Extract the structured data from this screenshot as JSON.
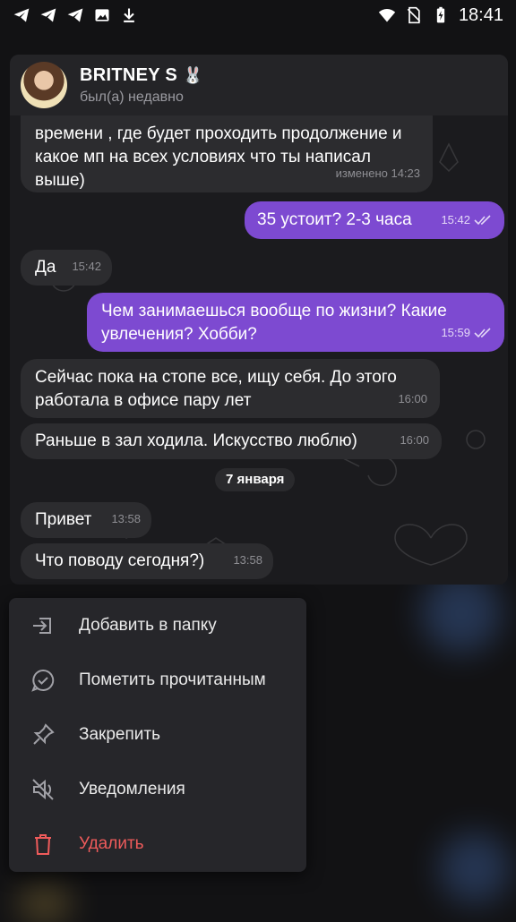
{
  "status_bar": {
    "time": "18:41",
    "left_icons": [
      "telegram-icon",
      "telegram-icon",
      "telegram-icon",
      "image-icon",
      "download-icon"
    ],
    "right_icons": [
      "wifi-icon",
      "no-sim-icon",
      "battery-charging-icon"
    ]
  },
  "chat": {
    "name": "BRITNEY S",
    "name_emoji": "🐰",
    "status": "был(а) недавно",
    "messages": [
      {
        "dir": "in",
        "text": "времени , где будет проходить продолжение и какое мп на всех условиях что ты написал выше)",
        "time": "изменено 14:23"
      },
      {
        "dir": "out",
        "text": "35 устоит? 2-3 часа",
        "time": "15:42",
        "read": true
      },
      {
        "dir": "in",
        "text": "Да",
        "time": "15:42"
      },
      {
        "dir": "out",
        "text": "Чем занимаешься вообще по жизни? Какие увлечения? Хобби?",
        "time": "15:59",
        "read": true
      },
      {
        "dir": "in",
        "text": "Сейчас пока на стопе все, ищу себя. До этого работала в офисе пару лет",
        "time": "16:00"
      },
      {
        "dir": "in",
        "text": "Раньше в зал ходила. Искусство люблю)",
        "time": "16:00"
      },
      {
        "dir": "in",
        "text": "Привет",
        "time": "13:58"
      },
      {
        "dir": "in",
        "text": "Что поводу сегодня?)",
        "time": "13:58"
      }
    ],
    "date_separator": "7 января"
  },
  "menu": {
    "items": [
      {
        "label": "Добавить в папку",
        "icon": "folder-add-icon"
      },
      {
        "label": "Пометить прочитанным",
        "icon": "mark-read-icon"
      },
      {
        "label": "Закрепить",
        "icon": "pin-icon"
      },
      {
        "label": "Уведомления",
        "icon": "mute-icon"
      },
      {
        "label": "Удалить",
        "icon": "trash-icon",
        "danger": true
      }
    ]
  },
  "colors": {
    "outgoing_bubble": "#7d4ad1",
    "incoming_bubble": "#2c2c2f",
    "danger": "#ef5b5b"
  }
}
